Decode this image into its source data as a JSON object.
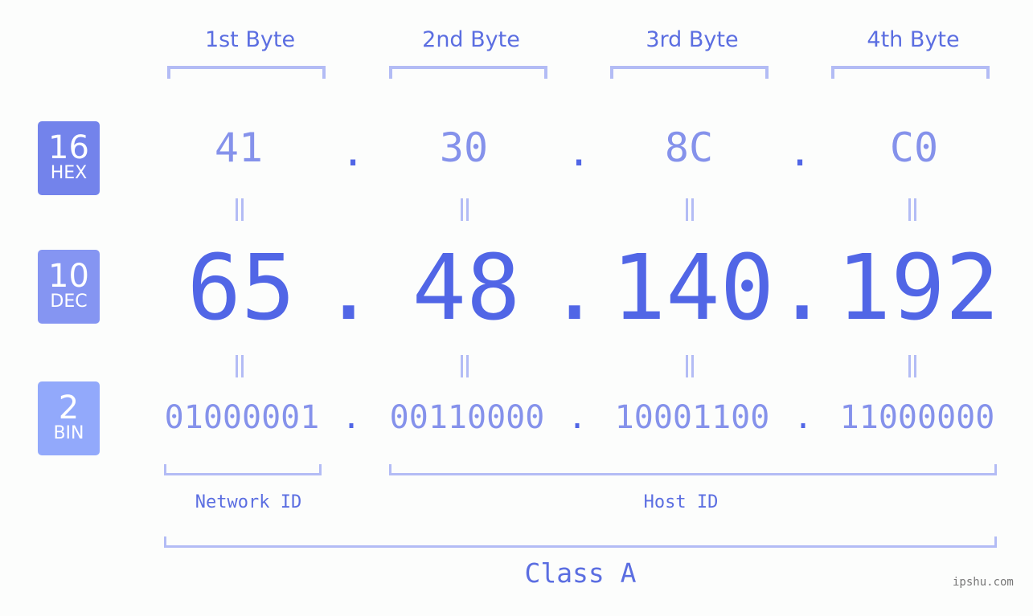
{
  "badges": [
    {
      "number": "16",
      "label": "HEX",
      "color": "#7383eb"
    },
    {
      "number": "10",
      "label": "DEC",
      "color": "#8595f2"
    },
    {
      "number": "2",
      "label": "BIN",
      "color": "#92a9fb"
    }
  ],
  "byte_headers": [
    "1st Byte",
    "2nd Byte",
    "3rd Byte",
    "4th Byte"
  ],
  "hex": [
    "41",
    "30",
    "8C",
    "C0"
  ],
  "dec": [
    "65",
    "48",
    "140",
    "192"
  ],
  "bin": [
    "01000001",
    "00110000",
    "10001100",
    "11000000"
  ],
  "separator": ".",
  "network_label": "Network ID",
  "host_label": "Host ID",
  "class_label": "Class A",
  "watermark": "ipshu.com",
  "colors": {
    "accent": "#5166e6",
    "light": "#8592eb",
    "bracket": "#b3bcf5"
  }
}
